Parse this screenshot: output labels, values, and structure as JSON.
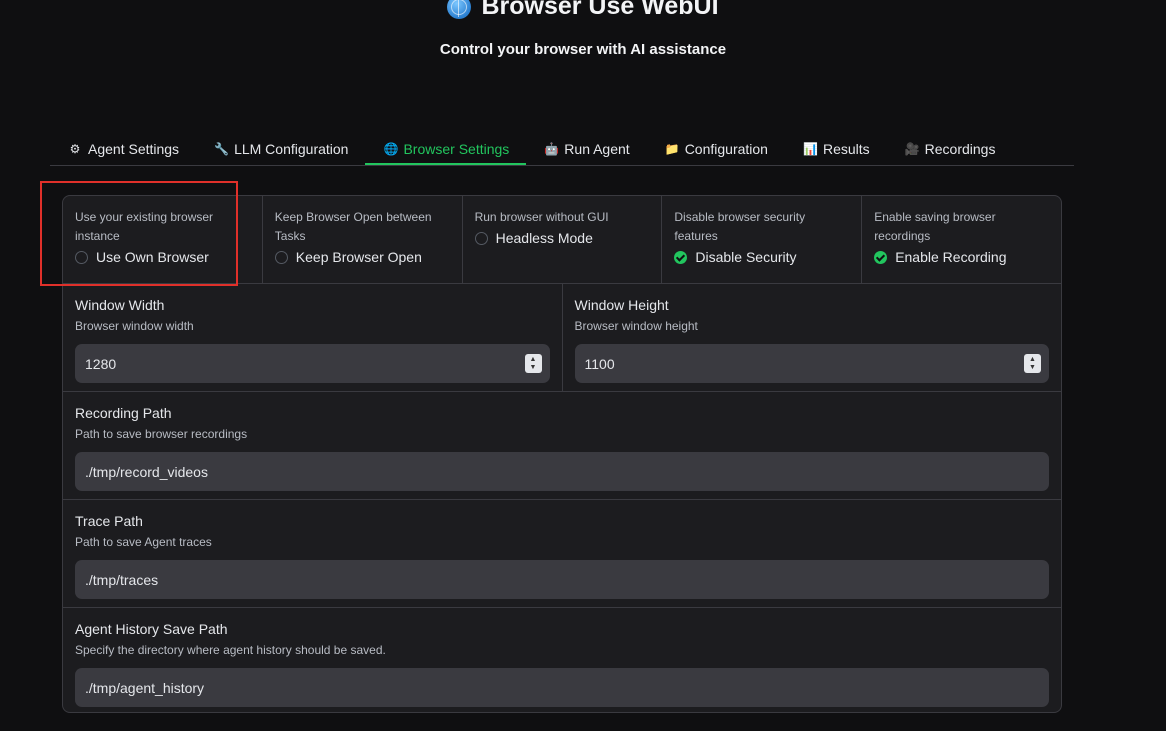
{
  "header": {
    "title": "Browser Use WebUI",
    "subtitle": "Control your browser with AI assistance",
    "title_icon": "globe-icon"
  },
  "tabs": [
    {
      "icon": "⚙",
      "icon_name": "gear-icon",
      "label": "Agent Settings"
    },
    {
      "icon": "🔧",
      "icon_name": "wrench-icon",
      "label": "LLM Configuration"
    },
    {
      "icon": "🌐",
      "icon_name": "globe-icon",
      "label": "Browser Settings"
    },
    {
      "icon": "🤖",
      "icon_name": "robot-icon",
      "label": "Run Agent"
    },
    {
      "icon": "📁",
      "icon_name": "folder-icon",
      "label": "Configuration"
    },
    {
      "icon": "📊",
      "icon_name": "chart-icon",
      "label": "Results"
    },
    {
      "icon": "🎥",
      "icon_name": "camera-icon",
      "label": "Recordings"
    }
  ],
  "active_tab": "Browser Settings",
  "checkboxes": [
    {
      "info": "Use your existing browser instance",
      "label": "Use Own Browser",
      "checked": false
    },
    {
      "info": "Keep Browser Open between Tasks",
      "label": "Keep Browser Open",
      "checked": false
    },
    {
      "info": "Run browser without GUI",
      "label": "Headless Mode",
      "checked": false
    },
    {
      "info": "Disable browser security features",
      "label": "Disable Security",
      "checked": true
    },
    {
      "info": "Enable saving browser recordings",
      "label": "Enable Recording",
      "checked": true
    }
  ],
  "window_width": {
    "label": "Window Width",
    "info": "Browser window width",
    "value": "1280"
  },
  "window_height": {
    "label": "Window Height",
    "info": "Browser window height",
    "value": "1100"
  },
  "recording_path": {
    "label": "Recording Path",
    "info": "Path to save browser recordings",
    "value": "./tmp/record_videos"
  },
  "trace_path": {
    "label": "Trace Path",
    "info": "Path to save Agent traces",
    "value": "./tmp/traces"
  },
  "history_path": {
    "label": "Agent History Save Path",
    "info": "Specify the directory where agent history should be saved.",
    "value": "./tmp/agent_history"
  },
  "colors": {
    "accent": "#22c55e",
    "highlight": "#e0302a",
    "background": "#0f0f11",
    "panel": "#1c1c1f"
  }
}
